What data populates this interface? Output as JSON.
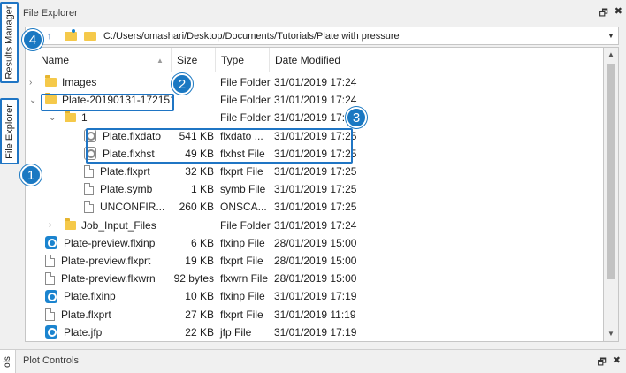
{
  "side_tabs": {
    "results_manager": "Results Manager",
    "file_explorer": "File Explorer"
  },
  "panel": {
    "title": "File Explorer",
    "pin_icon": "restore-icon",
    "close_glyph": "✖"
  },
  "path": {
    "value": "C:/Users/omashari/Desktop/Documents/Tutorials/Plate with pressure"
  },
  "columns": {
    "name": "Name",
    "size": "Size",
    "type": "Type",
    "modified": "Date Modified"
  },
  "rows": [
    {
      "name": "Images",
      "size": "",
      "type": "File Folder",
      "modified": "31/01/2019 17:24",
      "icon": "folder",
      "indent": 0,
      "chev": "›"
    },
    {
      "name": "Plate-20190131-172151",
      "size": "",
      "type": "File Folder",
      "modified": "31/01/2019 17:24",
      "icon": "folder",
      "indent": 0,
      "chev": "⌄"
    },
    {
      "name": "1",
      "size": "",
      "type": "File Folder",
      "modified": "31/01/2019 17:25",
      "icon": "folder",
      "indent": 1,
      "chev": "⌄"
    },
    {
      "name": "Plate.flxdato",
      "size": "541 KB",
      "type": "flxdato ...",
      "modified": "31/01/2019 17:25",
      "icon": "flx-grey",
      "indent": 2,
      "chev": ""
    },
    {
      "name": "Plate.flxhst",
      "size": "49 KB",
      "type": "flxhst File",
      "modified": "31/01/2019 17:25",
      "icon": "flx-grey",
      "indent": 2,
      "chev": ""
    },
    {
      "name": "Plate.flxprt",
      "size": "32 KB",
      "type": "flxprt File",
      "modified": "31/01/2019 17:25",
      "icon": "file",
      "indent": 2,
      "chev": ""
    },
    {
      "name": "Plate.symb",
      "size": "1 KB",
      "type": "symb File",
      "modified": "31/01/2019 17:25",
      "icon": "file",
      "indent": 2,
      "chev": ""
    },
    {
      "name": "UNCONFIR...",
      "size": "260 KB",
      "type": "ONSCA...",
      "modified": "31/01/2019 17:25",
      "icon": "file",
      "indent": 2,
      "chev": ""
    },
    {
      "name": "Job_Input_Files",
      "size": "",
      "type": "File Folder",
      "modified": "31/01/2019 17:24",
      "icon": "folder",
      "indent": 1,
      "chev": "›"
    },
    {
      "name": "Plate-preview.flxinp",
      "size": "6 KB",
      "type": "flxinp File",
      "modified": "28/01/2019 15:00",
      "icon": "flx",
      "indent": 0,
      "chev": ""
    },
    {
      "name": "Plate-preview.flxprt",
      "size": "19 KB",
      "type": "flxprt File",
      "modified": "28/01/2019 15:00",
      "icon": "file",
      "indent": 0,
      "chev": ""
    },
    {
      "name": "Plate-preview.flxwrn",
      "size": "92 bytes",
      "type": "flxwrn File",
      "modified": "28/01/2019 15:00",
      "icon": "file",
      "indent": 0,
      "chev": ""
    },
    {
      "name": "Plate.flxinp",
      "size": "10 KB",
      "type": "flxinp File",
      "modified": "31/01/2019 17:19",
      "icon": "flx",
      "indent": 0,
      "chev": ""
    },
    {
      "name": "Plate.flxprt",
      "size": "27 KB",
      "type": "flxprt File",
      "modified": "31/01/2019 11:19",
      "icon": "file",
      "indent": 0,
      "chev": ""
    },
    {
      "name": "Plate.jfp",
      "size": "22 KB",
      "type": "jfp File",
      "modified": "31/01/2019 17:19",
      "icon": "flx",
      "indent": 0,
      "chev": ""
    }
  ],
  "callouts": [
    "1",
    "2",
    "3",
    "4"
  ],
  "bottom": {
    "title": "Plot Controls",
    "vtab": "ols"
  },
  "colors": {
    "accent": "#1a78c2",
    "folder": "#f5c94a"
  }
}
